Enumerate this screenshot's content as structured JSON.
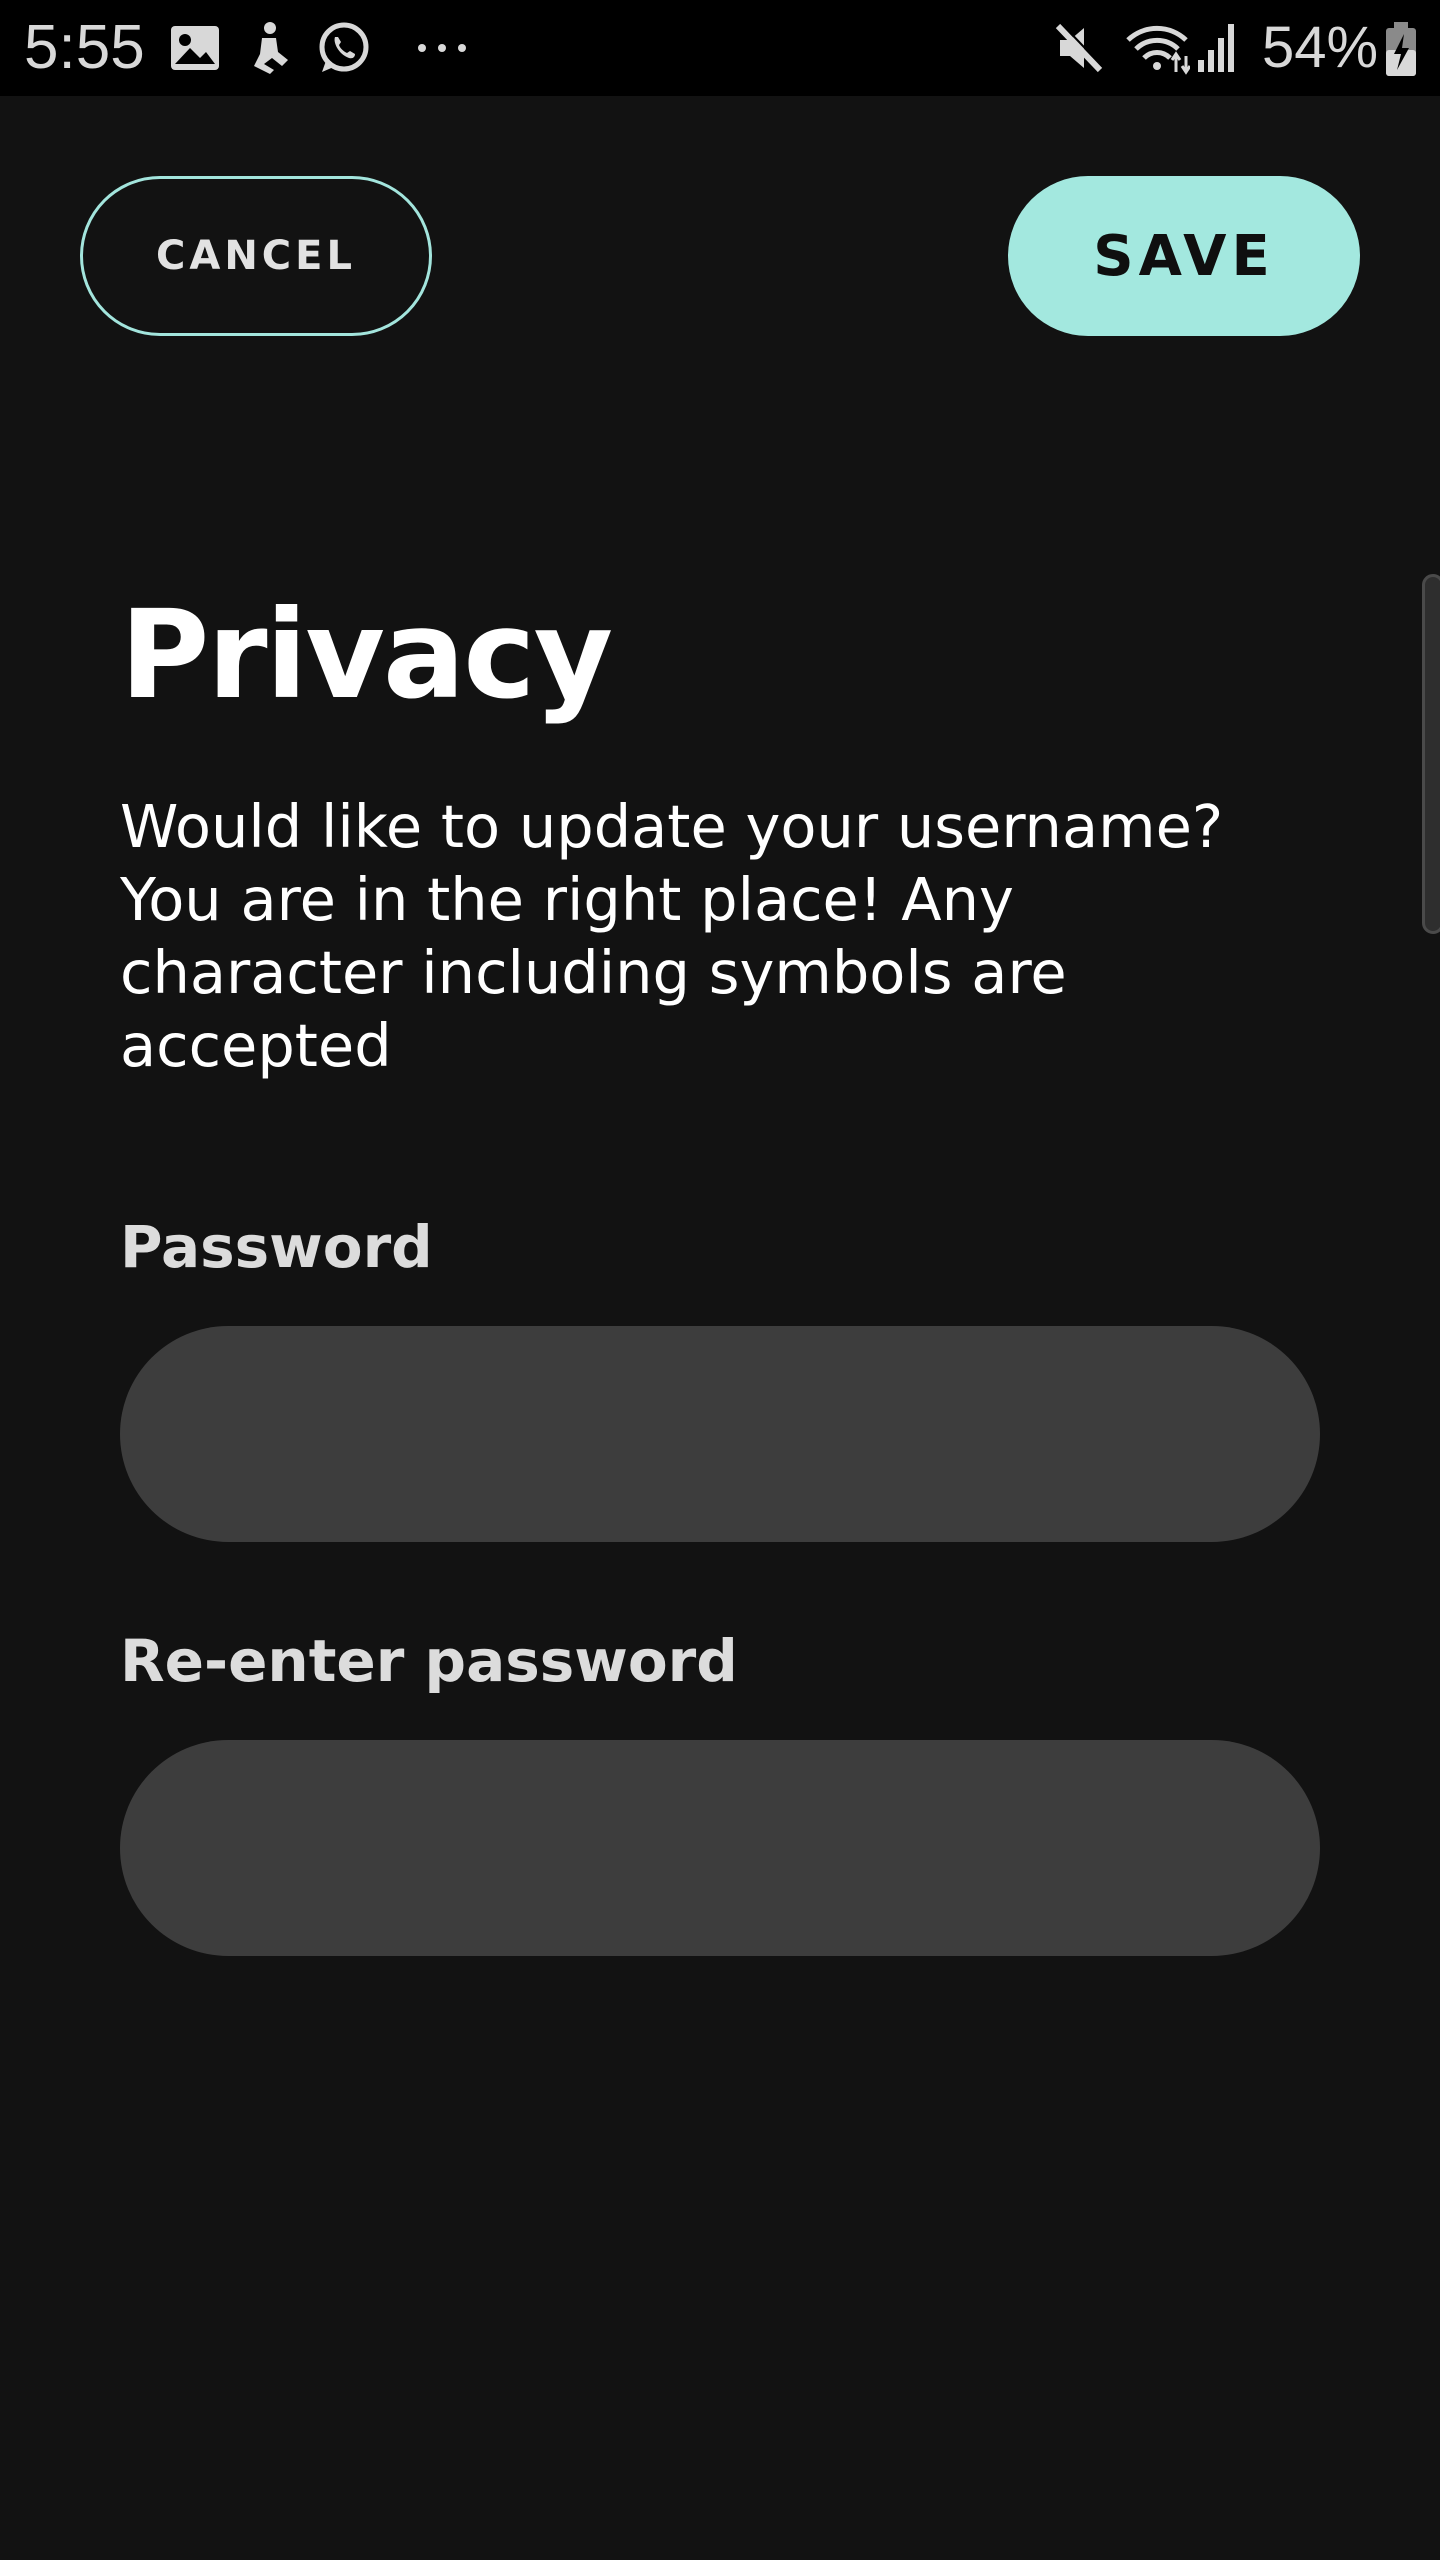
{
  "status_bar": {
    "time": "5:55",
    "battery_percent": "54%",
    "icons": [
      "gallery-icon",
      "figure-icon",
      "whatsapp-icon",
      "more-icon",
      "mute-icon",
      "wifi-icon",
      "signal-icon",
      "battery-charging-icon"
    ],
    "text_color": "#d8d8d8"
  },
  "actions": {
    "cancel_label": "CANCEL",
    "save_label": "SAVE"
  },
  "page": {
    "title": "Privacy",
    "description": "Would like to update your username? You are in the right place! Any character including symbols are accepted"
  },
  "form": {
    "password": {
      "label": "Password",
      "value": ""
    },
    "reenter_password": {
      "label": "Re-enter password",
      "value": ""
    }
  },
  "colors": {
    "background": "#121212",
    "accent": "#a3e8df",
    "field_background": "#3d3d3d",
    "text_primary": "#ffffff",
    "text_label": "#dcdcdc"
  }
}
